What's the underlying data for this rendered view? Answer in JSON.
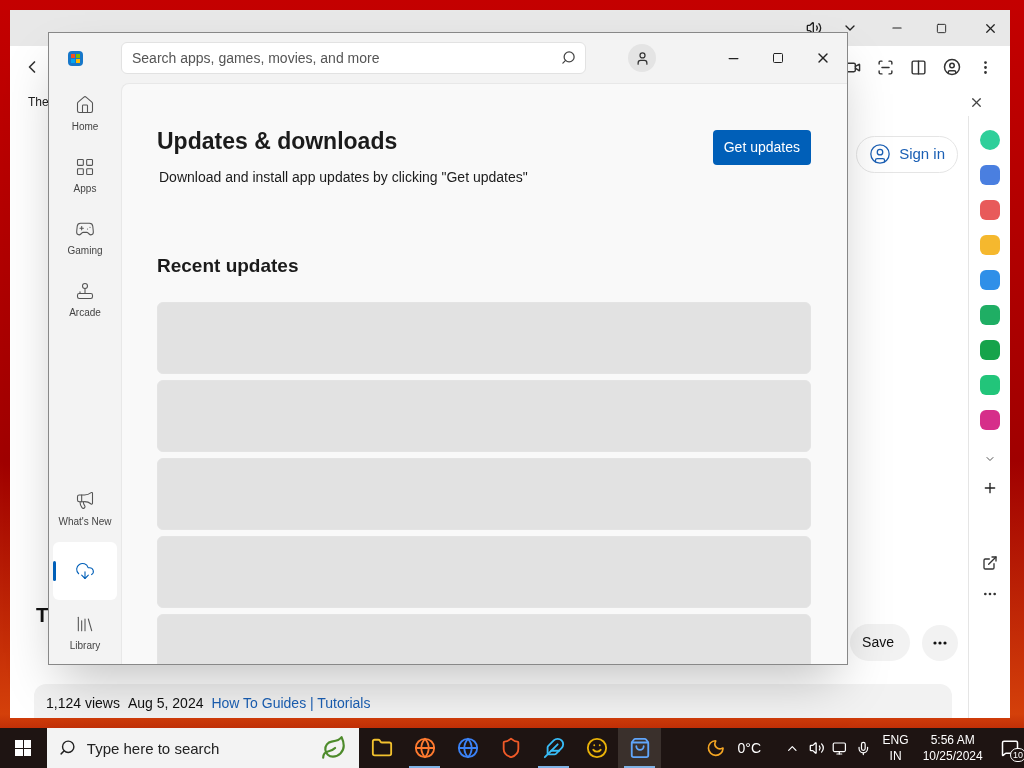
{
  "browser": {
    "page": {
      "partial_texts": [
        "The",
        "T"
      ],
      "sign_in": "Sign in",
      "views": "1,124 views",
      "date": "Aug 5, 2024",
      "link": "How To Guides | Tutorials",
      "save": "Save"
    },
    "sidebar_apps": [
      {
        "color": "#2ecf9a"
      },
      {
        "color": "#4a7fe0"
      },
      {
        "color": "#e85a5a"
      },
      {
        "color": "#f5b82e"
      },
      {
        "color": "#2f8fe8"
      },
      {
        "color": "#1fae64"
      },
      {
        "color": "#16a34a"
      },
      {
        "color": "#22c57a"
      },
      {
        "color": "#d62e8a"
      }
    ]
  },
  "store": {
    "search": {
      "placeholder": "Search apps, games, movies, and more"
    },
    "nav_top": [
      {
        "label": "Home",
        "kind": "home",
        "selected": false
      },
      {
        "label": "Apps",
        "kind": "apps",
        "selected": false
      },
      {
        "label": "Gaming",
        "kind": "gaming",
        "selected": false
      },
      {
        "label": "Arcade",
        "kind": "arcade",
        "selected": false
      }
    ],
    "nav_bottom": [
      {
        "label": "What's New",
        "kind": "whatsnew",
        "selected": false
      },
      {
        "kind": "downloads",
        "selected": true
      },
      {
        "label": "Library",
        "kind": "library",
        "selected": false
      }
    ],
    "title": "Updates & downloads",
    "subtitle": "Download and install app updates by clicking \"Get updates\"",
    "button": "Get updates",
    "section": "Recent updates",
    "rows": [
      {
        "kind": "skeleton"
      },
      {
        "kind": "skeleton"
      },
      {
        "kind": "skeleton"
      },
      {
        "kind": "skeleton"
      },
      {
        "kind": "skeleton"
      }
    ]
  },
  "taskbar": {
    "search": {
      "placeholder": "Type here to search"
    },
    "apps": [
      {
        "kind": "files",
        "selected": false,
        "running": false
      },
      {
        "kind": "firefox",
        "selected": false,
        "running": true
      },
      {
        "kind": "chrome",
        "selected": false,
        "running": false
      },
      {
        "kind": "brave",
        "selected": false,
        "running": false
      },
      {
        "kind": "bird",
        "selected": false,
        "running": true
      },
      {
        "kind": "mask",
        "selected": false,
        "running": false
      },
      {
        "kind": "store",
        "selected": true,
        "running": true
      }
    ],
    "temperature": "0°C",
    "language": "ENG",
    "region": "IN",
    "time": "5:56 AM",
    "date": "10/25/2024",
    "notifications": "10"
  }
}
